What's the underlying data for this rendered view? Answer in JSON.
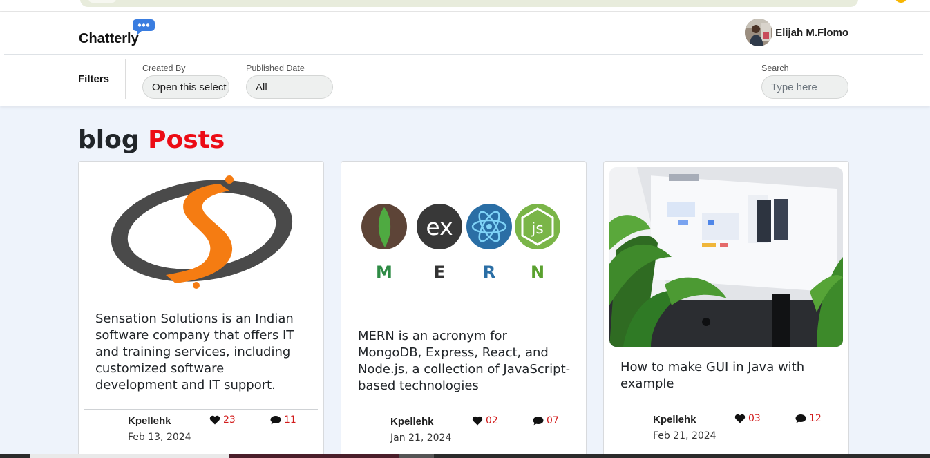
{
  "app": {
    "brand": "Chatterly"
  },
  "user": {
    "name": "Elijah M.Flomo"
  },
  "filters": {
    "label": "Filters",
    "created_by": {
      "label": "Created By",
      "value": "Open this select menu"
    },
    "published_date": {
      "label": "Published Date",
      "value": "All"
    },
    "search": {
      "label": "Search",
      "placeholder": "Type here"
    }
  },
  "heading": {
    "part1": "blog",
    "part2": "Posts"
  },
  "colors": {
    "accent": "#ec0b15",
    "likes": "#d21b1b",
    "page_bg": "#eef3fb"
  },
  "posts": [
    {
      "title": "Sensation Solutions is an Indian software company that offers IT and training services, including customized software development and IT support.",
      "author": "Kpellehk",
      "date": "Feb 13, 2024",
      "likes": "23",
      "comments": "11",
      "image": "sensation-solutions-logo"
    },
    {
      "title": "MERN is an acronym for MongoDB, Express, React, and Node.js, a collection of JavaScript-based technologies",
      "author": "Kpellehk",
      "date": "Jan 21, 2024",
      "likes": "02",
      "comments": "07",
      "image": "mern-stack-logos",
      "logo_letters": [
        "M",
        "E",
        "R",
        "N"
      ],
      "logo_marks": [
        "ex",
        "js"
      ]
    },
    {
      "title": "How to make GUI in Java with example",
      "author": "Kpellehk",
      "date": "Feb 21, 2024",
      "likes": "03",
      "comments": "12",
      "image": "imac-ui-design-photo"
    }
  ]
}
